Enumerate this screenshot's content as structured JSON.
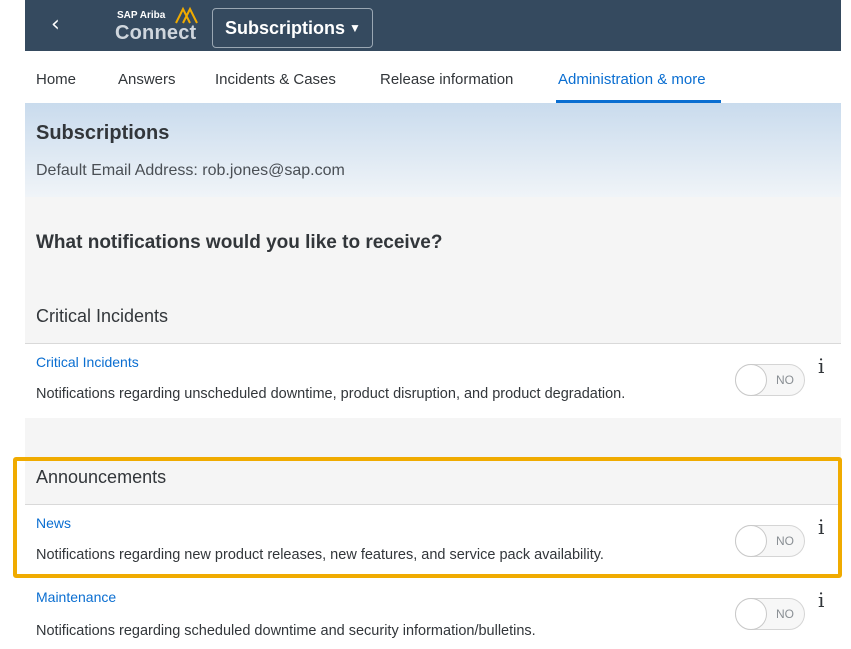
{
  "topbar": {
    "back_icon": "chevron-left-icon",
    "brand_top": "SAP Ariba",
    "brand_main": "Connect",
    "selector_label": "Subscriptions",
    "brand_color": "#354a5f",
    "logo_color": "#f0ab00"
  },
  "tabs": [
    {
      "label": "Home",
      "active": false
    },
    {
      "label": "Answers",
      "active": false
    },
    {
      "label": "Incidents & Cases",
      "active": false
    },
    {
      "label": "Release information",
      "active": false
    },
    {
      "label": "Administration & more",
      "active": true
    }
  ],
  "header": {
    "title": "Subscriptions",
    "email_line": "Default Email Address: rob.jones@sap.com"
  },
  "question": "What notifications would you like to receive?",
  "sections": [
    {
      "title": "Critical Incidents",
      "items": [
        {
          "link": "Critical Incidents",
          "description": "Notifications regarding unscheduled downtime, product disruption, and product degradation.",
          "toggle": "NO"
        }
      ]
    },
    {
      "title": "Announcements",
      "items": [
        {
          "link": "News",
          "description": "Notifications regarding new product releases, new features, and service pack availability.",
          "toggle": "NO"
        },
        {
          "link": "Maintenance",
          "description": "Notifications regarding scheduled downtime and security information/bulletins.",
          "toggle": "NO"
        }
      ]
    }
  ],
  "info_glyph": "i",
  "accent_color": "#0a6ed1",
  "highlight_color": "#f0ab00"
}
